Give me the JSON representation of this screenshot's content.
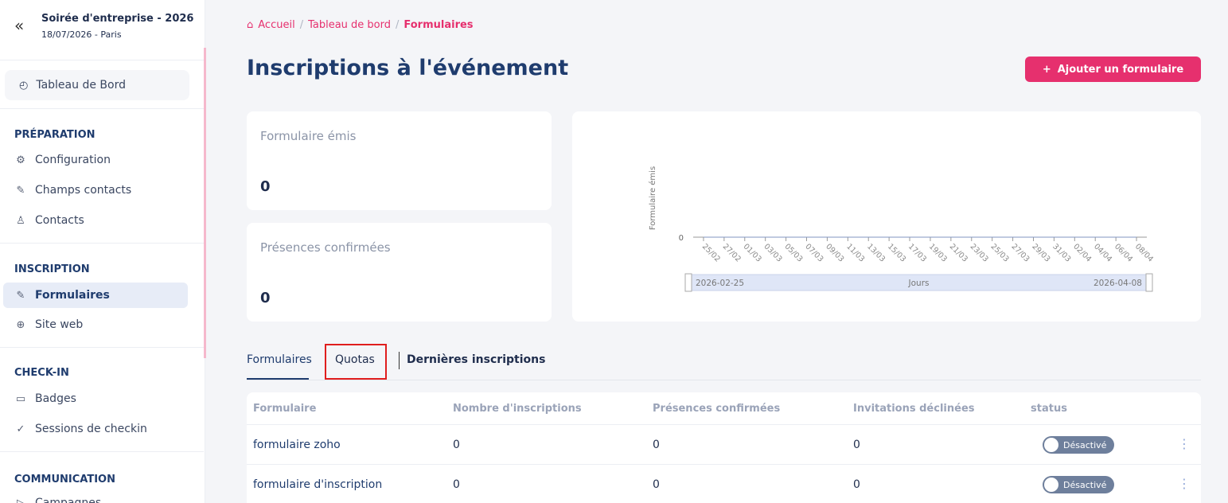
{
  "sidebar": {
    "collapse_icon": "«",
    "event_title": "Soirée d'entreprise - 2026",
    "event_subtitle": "18/07/2026 - Paris",
    "dashboard": {
      "label": "Tableau de Bord",
      "icon": "gauge-icon"
    },
    "sections": [
      {
        "title": "PRÉPARATION",
        "items": [
          {
            "label": "Configuration",
            "icon": "gear-icon"
          },
          {
            "label": "Champs contacts",
            "icon": "edit-icon"
          },
          {
            "label": "Contacts",
            "icon": "user-icon"
          }
        ]
      },
      {
        "title": "INSCRIPTION",
        "items": [
          {
            "label": "Formulaires",
            "icon": "edit-icon",
            "active": true
          },
          {
            "label": "Site web",
            "icon": "globe-icon"
          }
        ]
      },
      {
        "title": "CHECK-IN",
        "items": [
          {
            "label": "Badges",
            "icon": "badge-icon"
          },
          {
            "label": "Sessions de checkin",
            "icon": "check-circle-icon"
          }
        ]
      },
      {
        "title": "COMMUNICATION",
        "items": [
          {
            "label": "Campagnes",
            "icon": "send-icon"
          }
        ]
      }
    ]
  },
  "breadcrumb": {
    "home": "Accueil",
    "dashboard": "Tableau de bord",
    "current": "Formulaires",
    "separator": "/"
  },
  "page": {
    "title": "Inscriptions à l'événement",
    "add_button": "Ajouter un formulaire",
    "add_icon": "+"
  },
  "stats": [
    {
      "label": "Formulaire émis",
      "value": "0"
    },
    {
      "label": "Présences confirmées",
      "value": "0"
    }
  ],
  "chart_data": {
    "type": "line",
    "ylabel": "Formulaire émis",
    "xlabel": "Jours",
    "x": [
      "25/02",
      "27/02",
      "01/03",
      "03/03",
      "05/03",
      "07/03",
      "09/03",
      "11/03",
      "13/03",
      "15/03",
      "17/03",
      "19/03",
      "21/03",
      "23/03",
      "25/03",
      "27/03",
      "29/03",
      "31/03",
      "02/04",
      "04/04",
      "06/04",
      "08/04"
    ],
    "y_ticks": [
      "0"
    ],
    "series": [
      {
        "values": [
          0,
          0,
          0,
          0,
          0,
          0,
          0,
          0,
          0,
          0,
          0,
          0,
          0,
          0,
          0,
          0,
          0,
          0,
          0,
          0,
          0,
          0
        ]
      }
    ],
    "range_start": "2026-02-25",
    "range_end": "2026-04-08",
    "colors": {
      "slider": "#dfe6f7",
      "axis": "#999999"
    }
  },
  "tabs": {
    "formulaires": "Formulaires",
    "quotas": "Quotas",
    "dernieres": "Dernières inscriptions"
  },
  "table": {
    "headers": [
      "Formulaire",
      "Nombre d'inscriptions",
      "Présences confirmées",
      "Invitations déclinées",
      "status"
    ],
    "rows": [
      {
        "name": "formulaire zoho",
        "inscriptions": "0",
        "presences": "0",
        "declinees": "0",
        "status": "Désactivé"
      },
      {
        "name": "formulaire d'inscription",
        "inscriptions": "0",
        "presences": "0",
        "declinees": "0",
        "status": "Désactivé"
      }
    ],
    "kebab": "⋮"
  },
  "colors": {
    "accent": "#e6306e",
    "primary": "#1f3c6e",
    "status_off": "#6e7f9c"
  }
}
